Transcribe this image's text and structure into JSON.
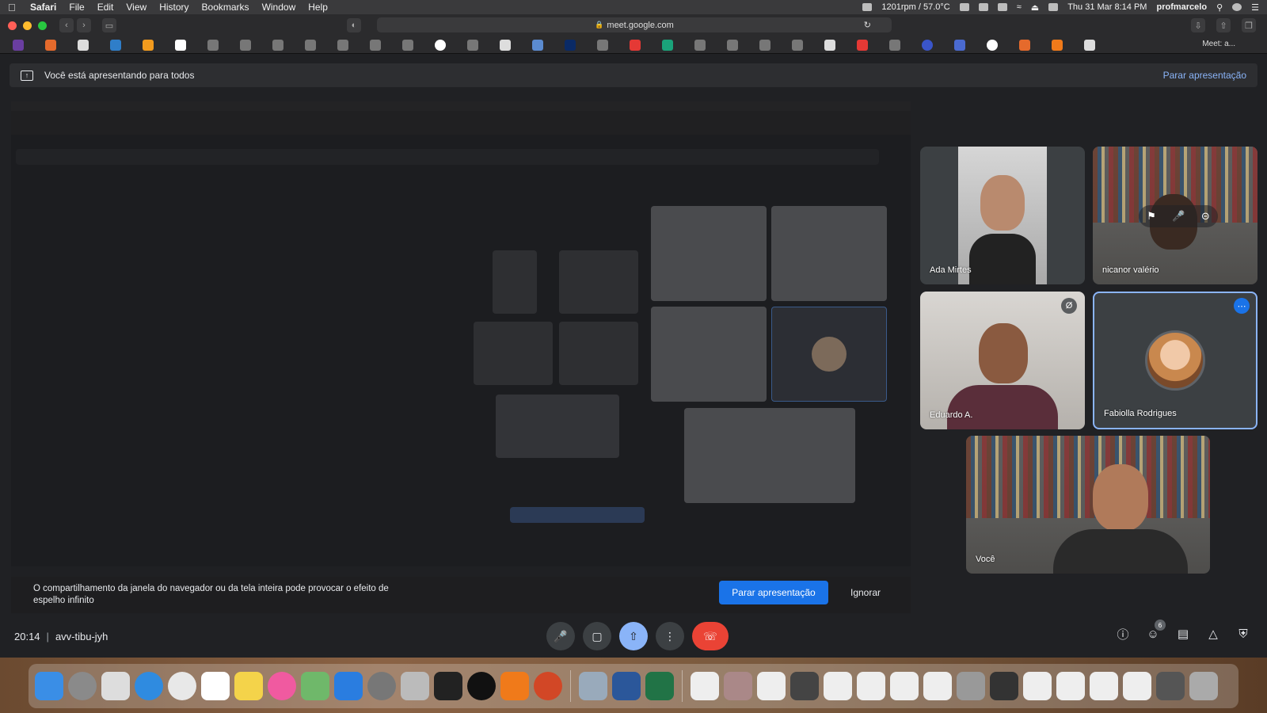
{
  "menubar": {
    "app": "Safari",
    "items": [
      "File",
      "Edit",
      "View",
      "History",
      "Bookmarks",
      "Window",
      "Help"
    ],
    "fan_status": "1201rpm / 57.0°C",
    "datetime": "Thu 31 Mar  8:14 PM",
    "user": "profmarcelo"
  },
  "browser": {
    "url": "meet.google.com",
    "tab_label": "Meet: a..."
  },
  "banner": {
    "text": "Você está apresentando para todos",
    "stop_link": "Parar apresentação"
  },
  "warning": {
    "text": "O compartilhamento da janela do navegador ou da tela inteira pode provocar o efeito de espelho infinito",
    "stop_button": "Parar apresentação",
    "ignore_button": "Ignorar"
  },
  "participants": [
    {
      "name": "Ada Mirtes"
    },
    {
      "name": "nicanor valério"
    },
    {
      "name": "Eduardo A."
    },
    {
      "name": "Fabiolla Rodrigues"
    },
    {
      "name": "Você"
    }
  ],
  "meeting": {
    "time": "20:14",
    "code": "avv-tibu-jyh",
    "participant_count": "6"
  },
  "colors": {
    "accent": "#8ab4f8",
    "primary_button": "#1a73e8",
    "end_call": "#ea4335",
    "background": "#202124"
  },
  "icons": {
    "mic": "mic-icon",
    "camera": "camera-icon",
    "present": "present-icon",
    "more": "more-vert-icon",
    "end_call": "end-call-icon",
    "info": "info-icon",
    "people": "people-icon",
    "chat": "chat-icon",
    "activities": "activities-icon",
    "host_controls": "shield-icon"
  }
}
